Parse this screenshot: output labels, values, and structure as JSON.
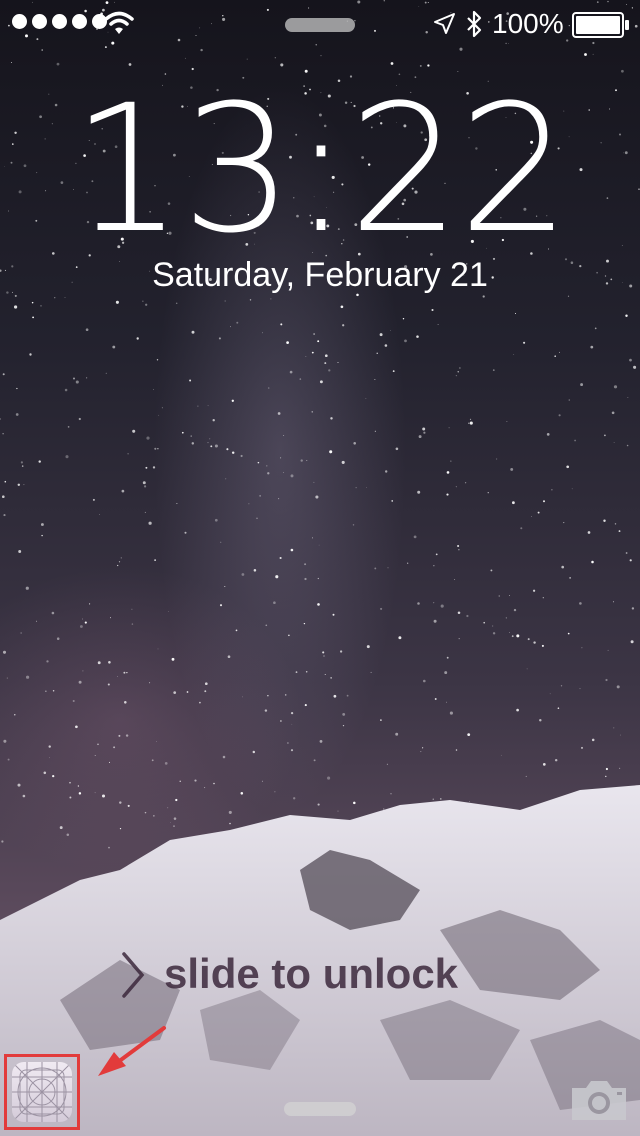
{
  "status_bar": {
    "signal_dots": 5,
    "wifi_icon": "wifi-icon",
    "location_icon": "location-arrow-icon",
    "bluetooth_icon": "bluetooth-icon",
    "battery_percent": "100%",
    "battery_level": 1.0
  },
  "lock_screen": {
    "time": "13:22",
    "date": "Saturday, February 21",
    "slide_label": "slide to unlock"
  },
  "bottom": {
    "app_icon": "app-template-icon",
    "camera_icon": "camera-icon",
    "annotation_color": "#e23b3b"
  }
}
